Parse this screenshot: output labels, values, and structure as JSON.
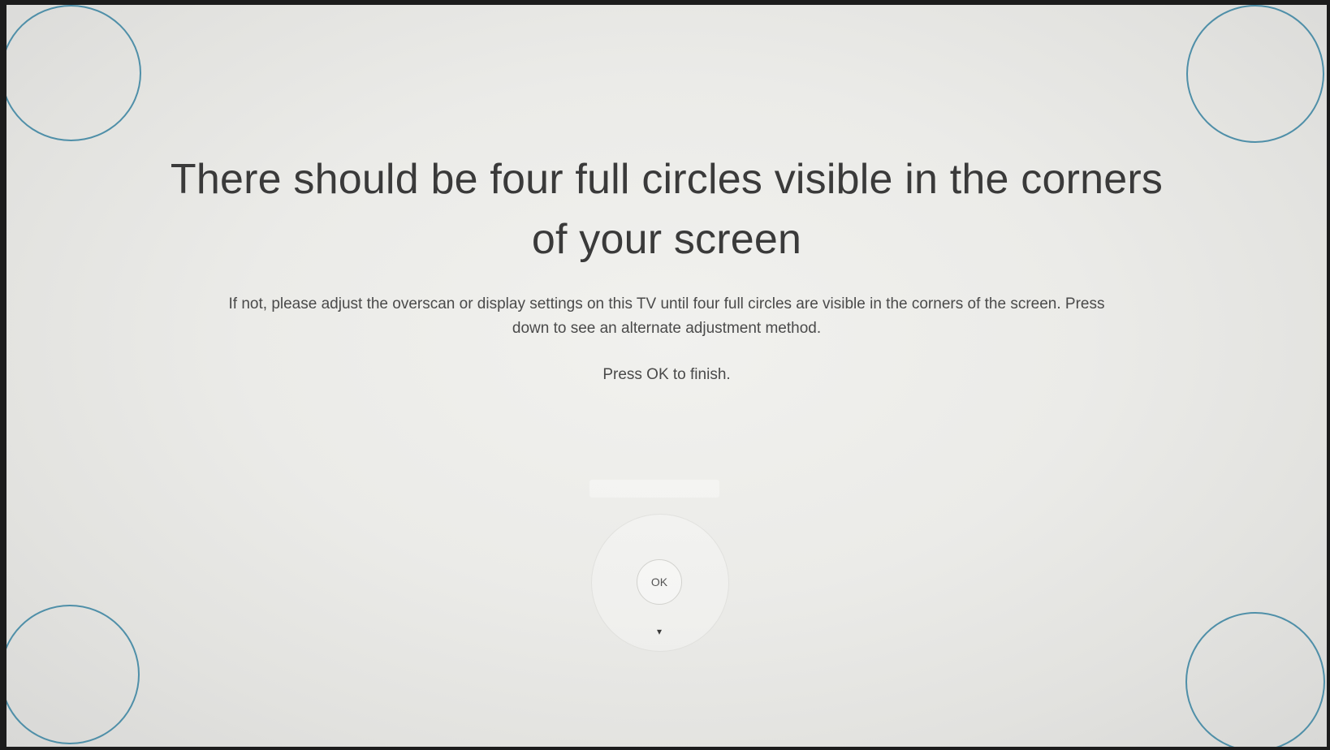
{
  "screen": {
    "headline": "There should be four full circles visible in the corners of your screen",
    "instructions": "If not, please adjust the overscan or display settings on this TV until four full circles are visible in the corners of the screen. Press down to see an alternate adjustment method.",
    "finish_hint": "Press OK to finish."
  },
  "remote": {
    "ok_label": "OK",
    "down_icon": "▾"
  },
  "colors": {
    "background": "#ebebe8",
    "circle_outline": "#4f8fa8",
    "text": "#3a3a3a"
  },
  "icons": {
    "corner_marker": "circle-outline",
    "down": "triangle-down"
  }
}
